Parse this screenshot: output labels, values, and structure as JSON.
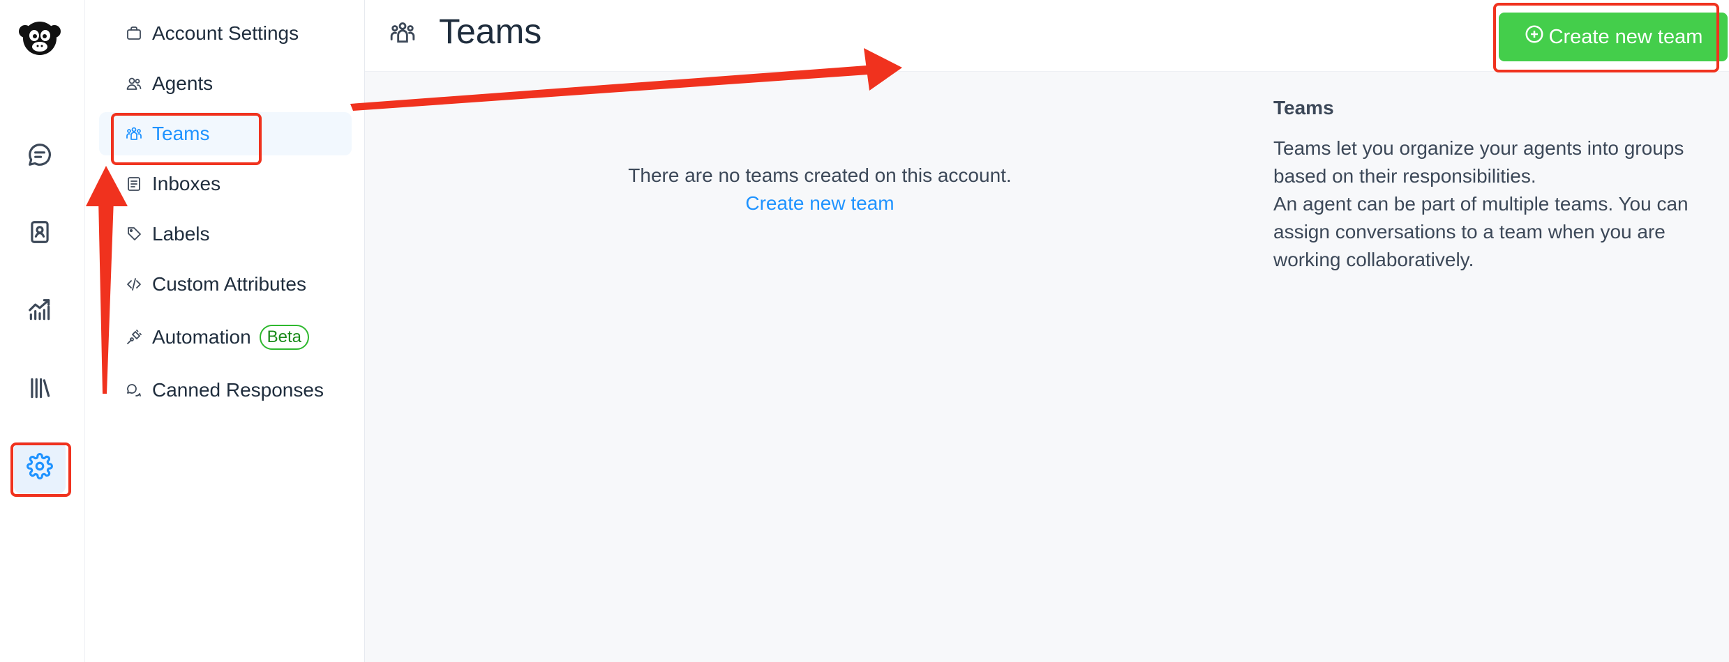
{
  "app": {
    "logo": "monkey-logo-icon"
  },
  "rail": {
    "items": [
      {
        "name": "conversations",
        "icon": "chat-bubble-icon",
        "active": false
      },
      {
        "name": "contacts",
        "icon": "contact-book-icon",
        "active": false
      },
      {
        "name": "reports",
        "icon": "chart-icon",
        "active": false
      },
      {
        "name": "library",
        "icon": "library-icon",
        "active": false
      },
      {
        "name": "settings",
        "icon": "gear-icon",
        "active": true
      }
    ]
  },
  "sidebar": {
    "items": [
      {
        "label": "Account Settings",
        "icon": "briefcase-icon"
      },
      {
        "label": "Agents",
        "icon": "people-icon"
      },
      {
        "label": "Teams",
        "icon": "team-icon",
        "active": true
      },
      {
        "label": "Inboxes",
        "icon": "inbox-icon"
      },
      {
        "label": "Labels",
        "icon": "tag-icon"
      },
      {
        "label": "Custom Attributes",
        "icon": "code-icon"
      },
      {
        "label": "Automation",
        "icon": "automation-icon",
        "badge": "Beta"
      },
      {
        "label": "Canned Responses",
        "icon": "chat-multiple-icon"
      }
    ]
  },
  "header": {
    "title": "Teams",
    "create_button": "Create new team"
  },
  "main": {
    "empty_message": "There are no teams created on this account.",
    "empty_link": "Create new team",
    "info_title": "Teams",
    "info_paragraphs": [
      "Teams let you organize your agents into groups based on their responsibilities.",
      "An agent can be part of multiple teams. You can assign conversations to a team when you are working collaboratively."
    ]
  },
  "annotation_color": "#f0321e",
  "accent_color": "#1f93ff",
  "button_color": "#44ce4b"
}
